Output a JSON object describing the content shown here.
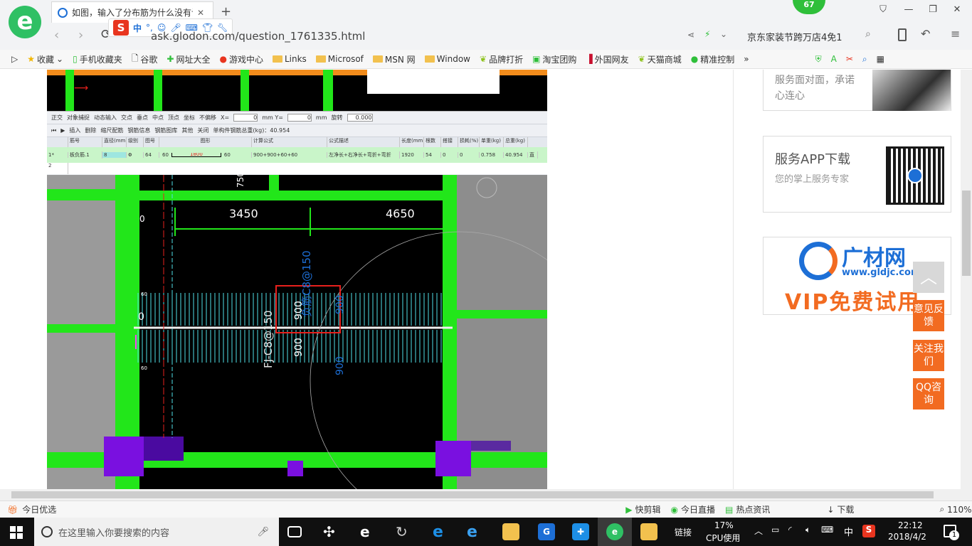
{
  "browser": {
    "tab_title": "如图，输入了分布筋为什么没有计",
    "notification_count": "67",
    "url": "http://ask.glodon.com/question_1761335.html",
    "url_visible": "ask.glodon.com/question_1761335.html",
    "ime_label": "中",
    "search_hint": "京东家装节跨万店4免1",
    "zoom": "110%"
  },
  "bookmarks": [
    {
      "label": "收藏",
      "icon": "star-icon"
    },
    {
      "label": "手机收藏夹",
      "icon": "phone-icon"
    },
    {
      "label": "谷歌",
      "icon": "page-icon"
    },
    {
      "label": "网址大全",
      "icon": "globe-icon"
    },
    {
      "label": "游戏中心",
      "icon": "game-icon"
    },
    {
      "label": "Links",
      "icon": "folder-icon"
    },
    {
      "label": "Microsof",
      "icon": "folder-icon"
    },
    {
      "label": "MSN 网",
      "icon": "folder-icon"
    },
    {
      "label": "Window",
      "icon": "folder-icon"
    },
    {
      "label": "品牌打折",
      "icon": "leaf-icon"
    },
    {
      "label": "淘宝团购",
      "icon": "taobao-icon"
    },
    {
      "label": "外国网友",
      "icon": "flag-icon"
    },
    {
      "label": "天猫商城",
      "icon": "leaf-icon"
    },
    {
      "label": "精准控制",
      "icon": "chat-icon"
    }
  ],
  "cad": {
    "toolbar1": [
      "正交",
      "对象捕捉",
      "动态输入",
      "交点",
      "垂点",
      "中点",
      "顶点",
      "坐标",
      "不偏移"
    ],
    "x_label": "X=",
    "x_value": "0",
    "y_label": "mm Y=",
    "y_value": "0",
    "mm_label": "mm",
    "rotate_label": "旋转",
    "rotate_value": "0.000",
    "toolbar2": [
      "插入",
      "删除",
      "缩尺配筋",
      "钢筋信息",
      "钢筋图库",
      "其他",
      "关闭"
    ],
    "total_weight": "单构件钢筋总重(kg)：40.954",
    "table_headers": [
      "筋号",
      "直径(mm)",
      "级别",
      "图号",
      "图形",
      "计算公式",
      "公式描述",
      "长度(mm)",
      "根数",
      "搭接",
      "损耗(%)",
      "单重(kg)",
      "总重(kg)"
    ],
    "row1": [
      "1*",
      "板负筋.1",
      "8",
      "Φ",
      "64",
      "60",
      "1800",
      "60",
      "900+900+60+60",
      "左净长+右净长+弯折+弯折",
      "1920",
      "54",
      "0",
      "0",
      "0.758",
      "40.954",
      "直"
    ],
    "row2_index": "2",
    "dim_3450": "3450",
    "dim_4650": "4650",
    "dim_750": "750",
    "dim_0a": "0",
    "dim_0b": "0",
    "dim_60a": "60",
    "dim_60b": "60",
    "label_fb": "FJ-C8@150",
    "label_dist": "负筋C8@150",
    "dim_900a": "900",
    "dim_900b": "900",
    "dim_900c": "900",
    "dim_900d": "900"
  },
  "sidebar": {
    "card1_text": "服务面对面，承诺心连心",
    "card2_title": "服务APP下载",
    "card2_text": "您的掌上服务专家",
    "ad_brand": "广材网",
    "ad_url": "www.gldjc.com",
    "ad_slogan": "VIP免费试用"
  },
  "floating": {
    "feedback": "意见反馈",
    "follow": "关注我们",
    "qq": "QQ咨询"
  },
  "statusbar": {
    "today": "今日优选",
    "items": [
      "快剪辑",
      "今日直播",
      "热点资讯",
      "下载"
    ],
    "zoom": "110%"
  },
  "taskbar": {
    "search_placeholder": "在这里输入你要搜索的内容",
    "link_label": "链接",
    "cpu_percent": "17%",
    "cpu_label": "CPU使用",
    "ime": "中",
    "time": "22:12",
    "date": "2018/4/2",
    "notify_count": "1"
  },
  "colors": {
    "cad_green": "#22e61a",
    "cad_cyan": "#4fe0e8",
    "cad_purple": "#7a10e0",
    "cad_red": "#e8201c",
    "accent_orange": "#f26b21",
    "blue_brand": "#1d6fd6"
  }
}
